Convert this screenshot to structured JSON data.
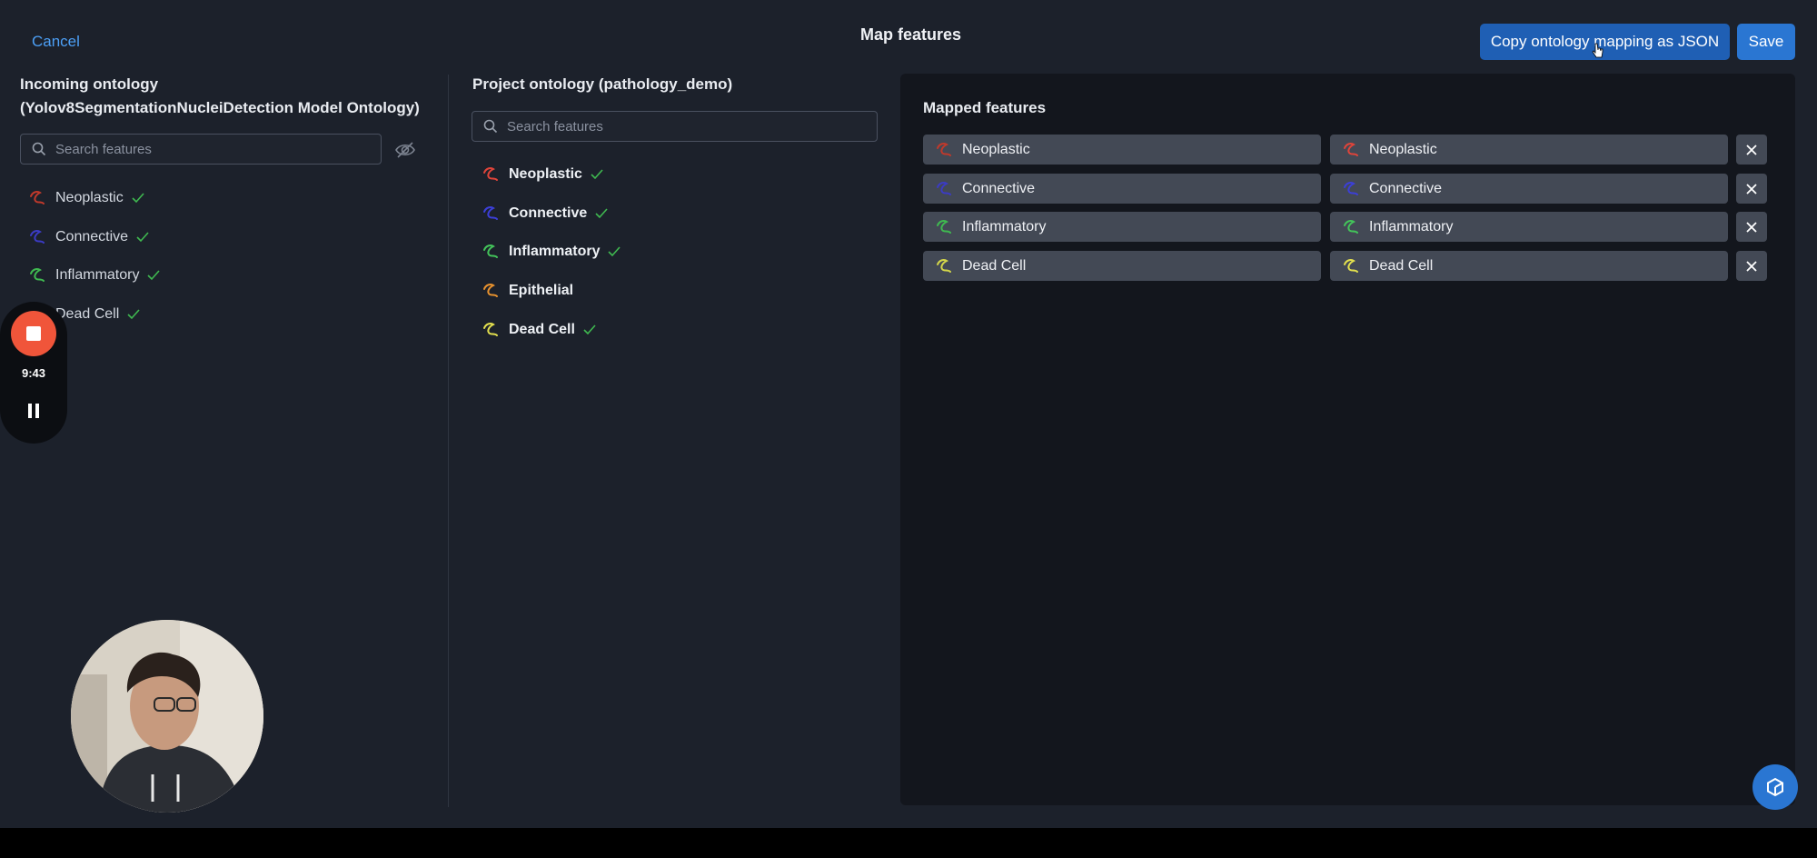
{
  "header": {
    "cancel_label": "Cancel",
    "title": "Map features",
    "copy_json_label": "Copy ontology mapping as JSON",
    "save_label": "Save"
  },
  "incoming": {
    "heading_line1": "Incoming ontology",
    "heading_line2": "(Yolov8SegmentationNucleiDetection Model Ontology)",
    "search_placeholder": "Search features",
    "features": [
      {
        "label": "Neoplastic",
        "color": "#c0392b",
        "checked": true
      },
      {
        "label": "Connective",
        "color": "#3b3bc4",
        "checked": true
      },
      {
        "label": "Inflammatory",
        "color": "#3fb950",
        "checked": true
      },
      {
        "label": "Dead Cell",
        "color": "#d4d64a",
        "checked": true
      }
    ]
  },
  "project": {
    "heading": "Project ontology (pathology_demo)",
    "search_placeholder": "Search features",
    "features": [
      {
        "label": "Neoplastic",
        "color": "#e0443a",
        "checked": true
      },
      {
        "label": "Connective",
        "color": "#3c3fd8",
        "checked": true
      },
      {
        "label": "Inflammatory",
        "color": "#43c45a",
        "checked": true
      },
      {
        "label": "Epithelial",
        "color": "#e8922e",
        "checked": false
      },
      {
        "label": "Dead Cell",
        "color": "#e3e04e",
        "checked": true
      }
    ]
  },
  "mapped": {
    "heading": "Mapped features",
    "rows": [
      {
        "incoming": "Neoplastic",
        "project": "Neoplastic",
        "in_color": "#c0392b",
        "proj_color": "#e0443a"
      },
      {
        "incoming": "Connective",
        "project": "Connective",
        "in_color": "#3b3bc4",
        "proj_color": "#3c3fd8"
      },
      {
        "incoming": "Inflammatory",
        "project": "Inflammatory",
        "in_color": "#3fb950",
        "proj_color": "#43c45a"
      },
      {
        "incoming": "Dead Cell",
        "project": "Dead Cell",
        "in_color": "#d4d64a",
        "proj_color": "#e3e04e"
      }
    ]
  },
  "recorder": {
    "time": "9:43"
  },
  "colors": {
    "accent": "#2a76d2",
    "link": "#4c9ff5",
    "record": "#f0553a",
    "check": "#3fb950"
  }
}
